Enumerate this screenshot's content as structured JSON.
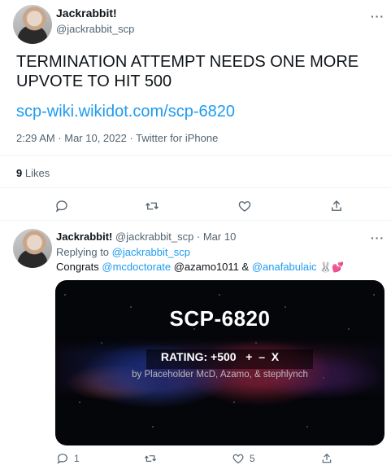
{
  "main_tweet": {
    "display_name": "Jackrabbit!",
    "handle": "@jackrabbit_scp",
    "text": "TERMINATION ATTEMPT NEEDS ONE MORE UPVOTE TO HIT 500",
    "link": "scp-wiki.wikidot.com/scp-6820",
    "meta": "2:29 AM · Mar 10, 2022 · Twitter for iPhone",
    "likes_count": "9",
    "likes_label": "Likes",
    "more_label": "···"
  },
  "reply_tweet": {
    "display_name": "Jackrabbit!",
    "handle_date": "@jackrabbit_scp · Mar 10",
    "replying_to_label": "Replying to",
    "replying_to_handle": "@jackrabbit_scp",
    "text_prefix": "Congrats",
    "mention_1": "@mcdoctorate",
    "mention_2": "@azamo1011",
    "text_amp": "&",
    "mention_3": "@anafabulaic",
    "emoji": "🐰💕",
    "more_label": "···",
    "reply_count": "1",
    "like_count": "5"
  },
  "card": {
    "title": "SCP-6820",
    "rating": "RATING: +500   +  –  X",
    "authors": "by Placeholder McD, Azamo, & stephlynch"
  },
  "icons": [
    "reply-icon",
    "retweet-icon",
    "like-icon",
    "share-icon",
    "more-icon"
  ],
  "colors": {
    "link": "#1d9bf0",
    "secondary": "#536471",
    "text": "#0f1419",
    "divider": "#eff3f4"
  }
}
